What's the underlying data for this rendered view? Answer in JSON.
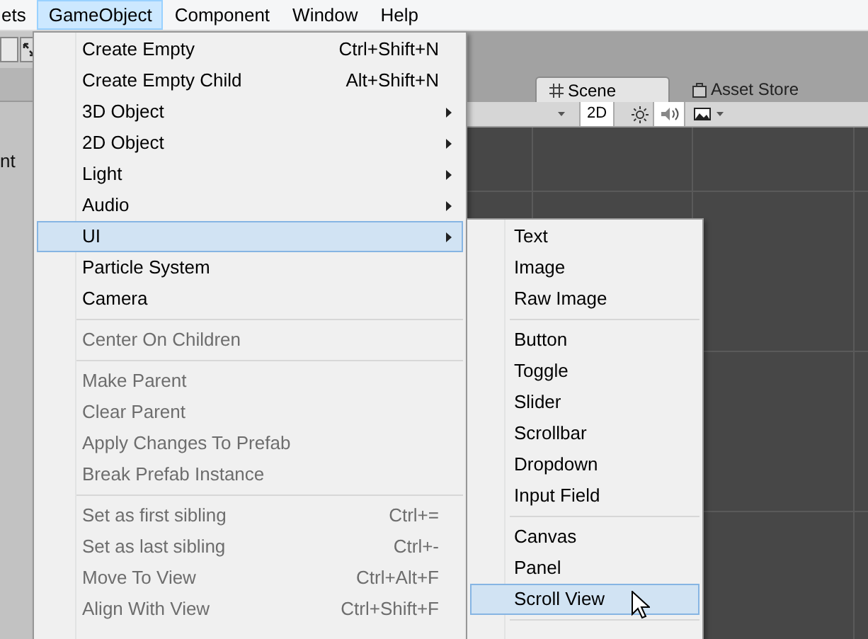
{
  "menu_bar": {
    "items": [
      {
        "label": "ets",
        "selected": false
      },
      {
        "label": "GameObject",
        "selected": true
      },
      {
        "label": "Component",
        "selected": false
      },
      {
        "label": "Window",
        "selected": false
      },
      {
        "label": "Help",
        "selected": false
      }
    ]
  },
  "editor": {
    "hierarchy_text": "nt",
    "tabs": [
      {
        "label": "Scene",
        "kind": "scene",
        "selected": true
      },
      {
        "label": "Asset Store",
        "kind": "store",
        "selected": false
      }
    ],
    "toolbar": {
      "mode_button": "2D"
    }
  },
  "gameobject_menu": {
    "items": [
      {
        "kind": "item",
        "label": "Create Empty",
        "shortcut": "Ctrl+Shift+N",
        "submenu": false,
        "disabled": false,
        "selected": false
      },
      {
        "kind": "item",
        "label": "Create Empty Child",
        "shortcut": "Alt+Shift+N",
        "submenu": false,
        "disabled": false,
        "selected": false
      },
      {
        "kind": "item",
        "label": "3D Object",
        "submenu": true,
        "disabled": false,
        "selected": false
      },
      {
        "kind": "item",
        "label": "2D Object",
        "submenu": true,
        "disabled": false,
        "selected": false
      },
      {
        "kind": "item",
        "label": "Light",
        "submenu": true,
        "disabled": false,
        "selected": false
      },
      {
        "kind": "item",
        "label": "Audio",
        "submenu": true,
        "disabled": false,
        "selected": false
      },
      {
        "kind": "item",
        "label": "UI",
        "submenu": true,
        "disabled": false,
        "selected": true
      },
      {
        "kind": "item",
        "label": "Particle System",
        "submenu": false,
        "disabled": false,
        "selected": false
      },
      {
        "kind": "item",
        "label": "Camera",
        "submenu": false,
        "disabled": false,
        "selected": false
      },
      {
        "kind": "separator"
      },
      {
        "kind": "item",
        "label": "Center On Children",
        "submenu": false,
        "disabled": true,
        "selected": false
      },
      {
        "kind": "separator"
      },
      {
        "kind": "item",
        "label": "Make Parent",
        "submenu": false,
        "disabled": true,
        "selected": false
      },
      {
        "kind": "item",
        "label": "Clear Parent",
        "submenu": false,
        "disabled": true,
        "selected": false
      },
      {
        "kind": "item",
        "label": "Apply Changes To Prefab",
        "submenu": false,
        "disabled": true,
        "selected": false
      },
      {
        "kind": "item",
        "label": "Break Prefab Instance",
        "submenu": false,
        "disabled": true,
        "selected": false
      },
      {
        "kind": "separator"
      },
      {
        "kind": "item",
        "label": "Set as first sibling",
        "shortcut": "Ctrl+=",
        "submenu": false,
        "disabled": true,
        "selected": false
      },
      {
        "kind": "item",
        "label": "Set as last sibling",
        "shortcut": "Ctrl+-",
        "submenu": false,
        "disabled": true,
        "selected": false
      },
      {
        "kind": "item",
        "label": "Move To View",
        "shortcut": "Ctrl+Alt+F",
        "submenu": false,
        "disabled": true,
        "selected": false
      },
      {
        "kind": "item",
        "label": "Align With View",
        "shortcut": "Ctrl+Shift+F",
        "submenu": false,
        "disabled": true,
        "selected": false
      }
    ]
  },
  "ui_submenu": {
    "items": [
      {
        "kind": "item",
        "label": "Text",
        "submenu": false,
        "disabled": false,
        "selected": false
      },
      {
        "kind": "item",
        "label": "Image",
        "submenu": false,
        "disabled": false,
        "selected": false
      },
      {
        "kind": "item",
        "label": "Raw Image",
        "submenu": false,
        "disabled": false,
        "selected": false
      },
      {
        "kind": "separator"
      },
      {
        "kind": "item",
        "label": "Button",
        "submenu": false,
        "disabled": false,
        "selected": false
      },
      {
        "kind": "item",
        "label": "Toggle",
        "submenu": false,
        "disabled": false,
        "selected": false
      },
      {
        "kind": "item",
        "label": "Slider",
        "submenu": false,
        "disabled": false,
        "selected": false
      },
      {
        "kind": "item",
        "label": "Scrollbar",
        "submenu": false,
        "disabled": false,
        "selected": false
      },
      {
        "kind": "item",
        "label": "Dropdown",
        "submenu": false,
        "disabled": false,
        "selected": false
      },
      {
        "kind": "item",
        "label": "Input Field",
        "submenu": false,
        "disabled": false,
        "selected": false
      },
      {
        "kind": "separator"
      },
      {
        "kind": "item",
        "label": "Canvas",
        "submenu": false,
        "disabled": false,
        "selected": false
      },
      {
        "kind": "item",
        "label": "Panel",
        "submenu": false,
        "disabled": false,
        "selected": false
      },
      {
        "kind": "item",
        "label": "Scroll View",
        "submenu": false,
        "disabled": false,
        "selected": true
      },
      {
        "kind": "separator"
      }
    ]
  }
}
